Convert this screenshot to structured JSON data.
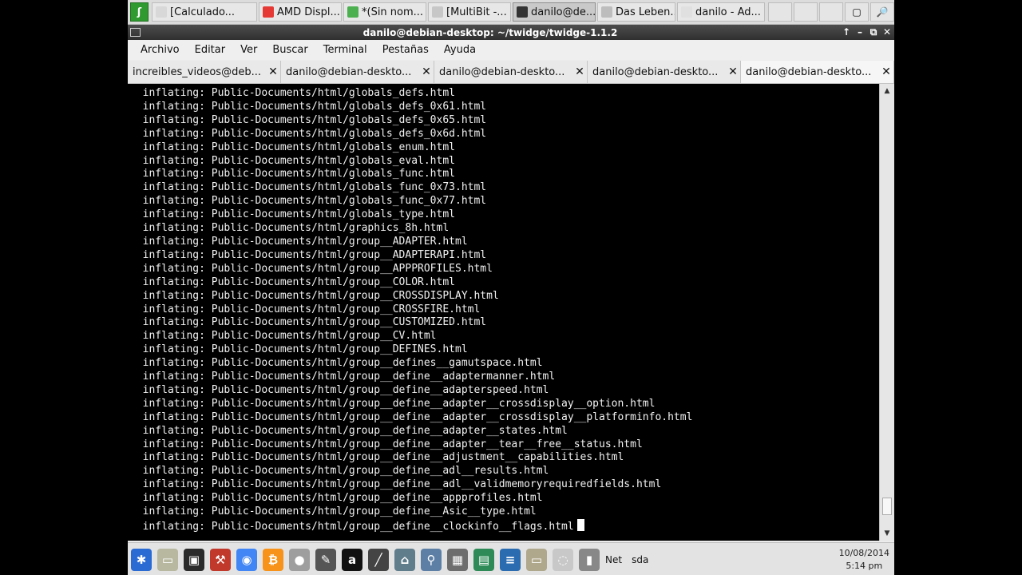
{
  "taskbar": {
    "launcher_icon": "debian-menu-icon",
    "tasks": [
      {
        "label": "[Calculado...",
        "icon_color": "#d8d8d8",
        "active": false
      },
      {
        "label": "AMD Displ...",
        "icon_color": "#e53935",
        "active": false
      },
      {
        "label": "*(Sin nom...",
        "icon_color": "#4caf50",
        "active": false
      },
      {
        "label": "[MultiBit -...",
        "icon_color": "#c7c7c7",
        "active": false
      },
      {
        "label": "danilo@de...",
        "icon_color": "#333333",
        "active": true
      },
      {
        "label": "Das Leben...",
        "icon_color": "#bdbdbd",
        "active": false
      },
      {
        "label": "danilo - Ad...",
        "icon_color": "#e0e0e0",
        "active": false
      }
    ]
  },
  "window": {
    "title": "danilo@debian-desktop: ~/twidge/twidge-1.1.2",
    "controls": [
      "↑",
      "–",
      "⧉",
      "✕"
    ]
  },
  "menubar": [
    "Archivo",
    "Editar",
    "Ver",
    "Buscar",
    "Terminal",
    "Pestañas",
    "Ayuda"
  ],
  "tabs": [
    {
      "label": "increibles_videos@deb...",
      "close": "✕",
      "active": false
    },
    {
      "label": "danilo@debian-deskto...",
      "close": "✕",
      "active": false
    },
    {
      "label": "danilo@debian-deskto...",
      "close": "✕",
      "active": false
    },
    {
      "label": "danilo@debian-deskto...",
      "close": "✕",
      "active": false
    },
    {
      "label": "danilo@debian-deskto...",
      "close": "✕",
      "active": true
    }
  ],
  "terminal": {
    "lines": [
      "  inflating: Public-Documents/html/globals_defs.html",
      "  inflating: Public-Documents/html/globals_defs_0x61.html",
      "  inflating: Public-Documents/html/globals_defs_0x65.html",
      "  inflating: Public-Documents/html/globals_defs_0x6d.html",
      "  inflating: Public-Documents/html/globals_enum.html",
      "  inflating: Public-Documents/html/globals_eval.html",
      "  inflating: Public-Documents/html/globals_func.html",
      "  inflating: Public-Documents/html/globals_func_0x73.html",
      "  inflating: Public-Documents/html/globals_func_0x77.html",
      "  inflating: Public-Documents/html/globals_type.html",
      "  inflating: Public-Documents/html/graphics_8h.html",
      "  inflating: Public-Documents/html/group__ADAPTER.html",
      "  inflating: Public-Documents/html/group__ADAPTERAPI.html",
      "  inflating: Public-Documents/html/group__APPPROFILES.html",
      "  inflating: Public-Documents/html/group__COLOR.html",
      "  inflating: Public-Documents/html/group__CROSSDISPLAY.html",
      "  inflating: Public-Documents/html/group__CROSSFIRE.html",
      "  inflating: Public-Documents/html/group__CUSTOMIZED.html",
      "  inflating: Public-Documents/html/group__CV.html",
      "  inflating: Public-Documents/html/group__DEFINES.html",
      "  inflating: Public-Documents/html/group__defines__gamutspace.html",
      "  inflating: Public-Documents/html/group__define__adaptermanner.html",
      "  inflating: Public-Documents/html/group__define__adapterspeed.html",
      "  inflating: Public-Documents/html/group__define__adapter__crossdisplay__option.html",
      "  inflating: Public-Documents/html/group__define__adapter__crossdisplay__platforminfo.html",
      "  inflating: Public-Documents/html/group__define__adapter__states.html",
      "  inflating: Public-Documents/html/group__define__adapter__tear__free__status.html",
      "  inflating: Public-Documents/html/group__define__adjustment__capabilities.html",
      "  inflating: Public-Documents/html/group__define__adl__results.html",
      "  inflating: Public-Documents/html/group__define__adl__validmemoryrequiredfields.html",
      "  inflating: Public-Documents/html/group__define__appprofiles.html",
      "  inflating: Public-Documents/html/group__define__Asic__type.html"
    ],
    "last_line": "  inflating: Public-Documents/html/group__define__clockinfo__flags.html"
  },
  "scrollbar": {
    "position_fraction": 0.97
  },
  "panel": {
    "icons": [
      {
        "name": "debian-swirl-icon",
        "color": "#2a6ad3"
      },
      {
        "name": "file-manager-icon",
        "color": "#b8b8a0"
      },
      {
        "name": "terminal-icon",
        "color": "#2b2b2b"
      },
      {
        "name": "tools-icon",
        "color": "#c0392b"
      },
      {
        "name": "chrome-icon",
        "color": "#4285f4"
      },
      {
        "name": "bitcoin-icon",
        "color": "#f7931a"
      },
      {
        "name": "disc-icon",
        "color": "#9e9e9e"
      },
      {
        "name": "pen-icon",
        "color": "#555555"
      },
      {
        "name": "amazon-icon",
        "color": "#111111"
      },
      {
        "name": "brush-icon",
        "color": "#444444"
      },
      {
        "name": "network-computer-icon",
        "color": "#607d8b"
      },
      {
        "name": "search-icon",
        "color": "#5d7fa6"
      },
      {
        "name": "calculator-icon",
        "color": "#6d6d6d"
      },
      {
        "name": "spreadsheet-icon",
        "color": "#2e8b57"
      },
      {
        "name": "document-icon",
        "color": "#2b6cb0"
      },
      {
        "name": "folder-icon",
        "color": "#b0a88c"
      },
      {
        "name": "archive-icon",
        "color": "#c8c8c8"
      },
      {
        "name": "battery-icon",
        "color": "#888888"
      }
    ],
    "net_label": "Net",
    "disk_label": "sda",
    "date": "10/08/2014",
    "time": "5:14 pm"
  }
}
